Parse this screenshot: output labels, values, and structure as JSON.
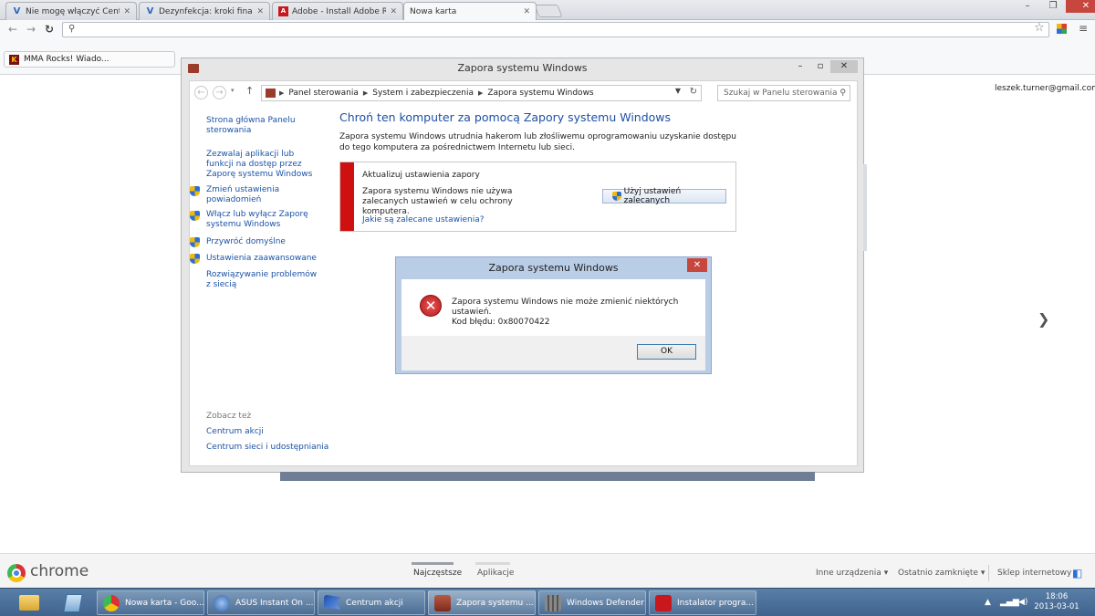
{
  "browser": {
    "tabs": [
      {
        "label": "Nie mogę włączyć Centru",
        "icon": "v-favicon-icon"
      },
      {
        "label": "Dezynfekcja: kroki finalizu",
        "icon": "v-favicon-icon"
      },
      {
        "label": "Adobe - Install Adobe Rea",
        "icon": "adobe-favicon-icon"
      },
      {
        "label": "Nowa karta",
        "icon": ""
      }
    ],
    "bookmark": "MMA Rocks! Wiado...",
    "account": "leszek.turner@gmail.com"
  },
  "control_panel": {
    "window_title": "Zapora systemu Windows",
    "breadcrumbs": [
      "Panel sterowania",
      "System i zabezpieczenia",
      "Zapora systemu Windows"
    ],
    "search_placeholder": "Szukaj w Panelu sterowania",
    "left_nav": [
      {
        "label": "Strona główna Panelu sterowania",
        "shield": false
      },
      {
        "label": "Zezwalaj aplikacji lub funkcji na dostęp przez Zaporę systemu Windows",
        "shield": false
      },
      {
        "label": "Zmień ustawienia powiadomień",
        "shield": true
      },
      {
        "label": "Włącz lub wyłącz Zaporę systemu Windows",
        "shield": true
      },
      {
        "label": "Przywróć domyślne",
        "shield": true
      },
      {
        "label": "Ustawienia zaawansowane",
        "shield": true
      },
      {
        "label": "Rozwiązywanie problemów z siecią",
        "shield": false
      }
    ],
    "see_also_title": "Zobacz też",
    "see_also": [
      "Centrum akcji",
      "Centrum sieci i udostępniania"
    ],
    "main_title": "Chroń ten komputer za pomocą Zapory systemu Windows",
    "main_desc": "Zapora systemu Windows utrudnia hakerom lub złośliwemu oprogramowaniu uzyskanie dostępu do tego komputera za pośrednictwem Internetu lub sieci.",
    "alert": {
      "title": "Aktualizuj ustawienia zapory",
      "text": "Zapora systemu Windows nie używa zalecanych ustawień w celu ochrony komputera.",
      "link": "Jakie są zalecane ustawienia?",
      "button": "Użyj ustawień zalecanych"
    }
  },
  "dialog": {
    "title": "Zapora systemu Windows",
    "message": "Zapora systemu Windows nie może zmienić niektórych ustawień.",
    "error_code": "Kod błędu: 0x80070422",
    "ok": "OK"
  },
  "ntp": {
    "logo_text": "chrome",
    "tabs": [
      "Najczęstsze",
      "Aplikacje"
    ],
    "links": [
      "Inne urządzenia",
      "Ostatnio zamknięte",
      "Sklep internetowy"
    ]
  },
  "taskbar": {
    "items": [
      {
        "label": "Nowa karta - Goo...",
        "icon": "chrome-icon",
        "color": "#db3236"
      },
      {
        "label": "ASUS Instant On ...",
        "icon": "asus-icon",
        "color": "#2d5fa8"
      },
      {
        "label": "Centrum akcji",
        "icon": "flag-icon",
        "color": "#1b4fb0"
      },
      {
        "label": "Zapora systemu ...",
        "icon": "firewall-icon",
        "color": "#9b3b2a"
      },
      {
        "label": "Windows Defender",
        "icon": "defender-icon",
        "color": "#6b6b6b"
      },
      {
        "label": "Instalator progra...",
        "icon": "adobe-icon",
        "color": "#c8171d"
      }
    ],
    "time": "18:06",
    "date": "2013-03-01"
  }
}
